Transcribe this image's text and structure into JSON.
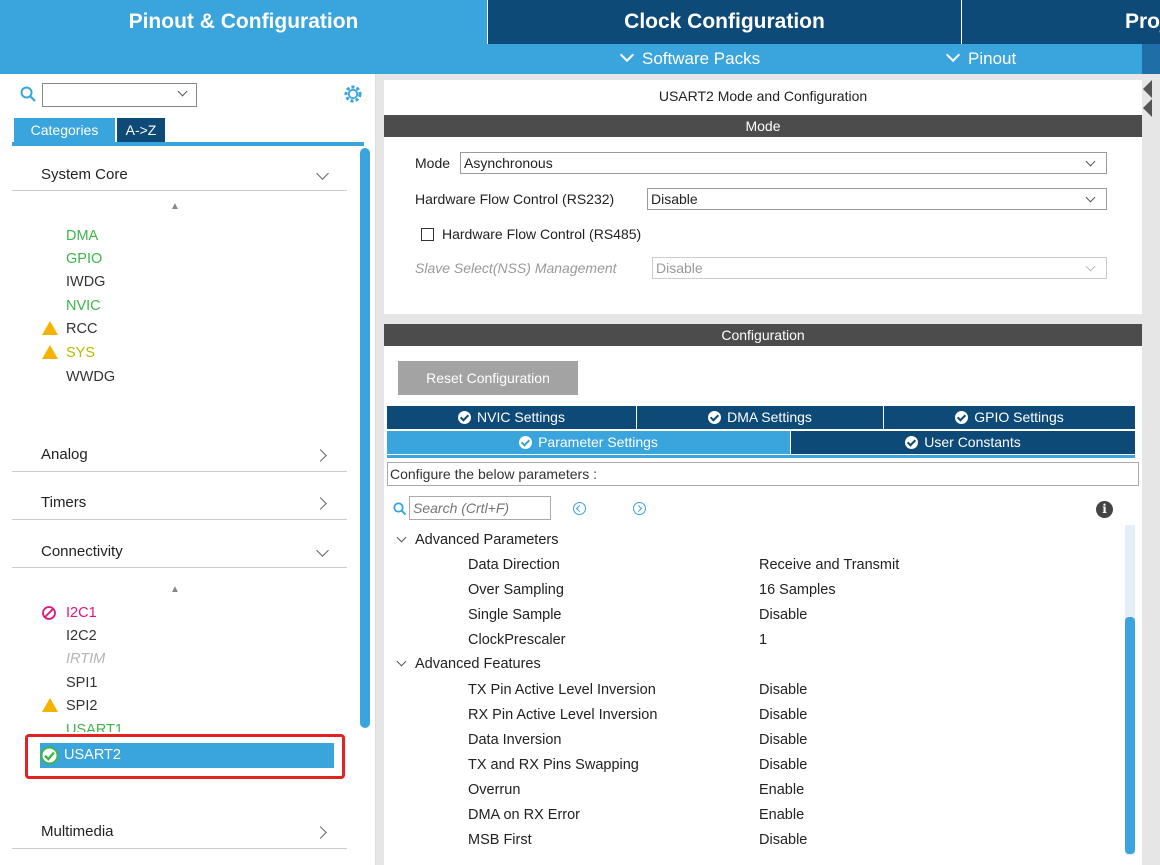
{
  "top_tabs": {
    "pinout": "Pinout & Configuration",
    "clock": "Clock Configuration",
    "project": "Proje"
  },
  "sub_menu": {
    "software_packs": "Software Packs",
    "pinout": "Pinout"
  },
  "left": {
    "search_value": "",
    "tabs": {
      "categories": "Categories",
      "az": "A->Z"
    },
    "groups": {
      "system_core": "System Core",
      "analog": "Analog",
      "timers": "Timers",
      "connectivity": "Connectivity",
      "multimedia": "Multimedia"
    },
    "system_core_items": [
      "DMA",
      "GPIO",
      "IWDG",
      "NVIC",
      "RCC",
      "SYS",
      "WWDG"
    ],
    "connectivity_items": [
      "I2C1",
      "I2C2",
      "IRTIM",
      "SPI1",
      "SPI2",
      "USART1",
      "USART2"
    ]
  },
  "mode_panel": {
    "title": "USART2 Mode and Configuration",
    "header": "Mode",
    "mode_label": "Mode",
    "mode_value": "Asynchronous",
    "hfc232_label": "Hardware Flow Control (RS232)",
    "hfc232_value": "Disable",
    "hfc485_label": "Hardware Flow Control (RS485)",
    "nss_label": "Slave Select(NSS) Management",
    "nss_value": "Disable"
  },
  "config_panel": {
    "header": "Configuration",
    "reset_button": "Reset Configuration",
    "tabs_row1": [
      "NVIC Settings",
      "DMA Settings",
      "GPIO Settings"
    ],
    "tabs_row2": [
      "Parameter Settings",
      "User Constants"
    ],
    "configure_text": "Configure the below parameters :",
    "search_placeholder": "Search (Crtl+F)",
    "sections": {
      "advanced_parameters": "Advanced Parameters",
      "advanced_features": "Advanced Features"
    },
    "advanced_parameters": [
      {
        "name": "Data Direction",
        "value": "Receive and Transmit"
      },
      {
        "name": "Over Sampling",
        "value": "16 Samples"
      },
      {
        "name": "Single Sample",
        "value": "Disable"
      },
      {
        "name": "ClockPrescaler",
        "value": "1"
      }
    ],
    "advanced_features": [
      {
        "name": "TX Pin Active Level Inversion",
        "value": "Disable"
      },
      {
        "name": "RX Pin Active Level Inversion",
        "value": "Disable"
      },
      {
        "name": "Data Inversion",
        "value": "Disable"
      },
      {
        "name": "TX and RX Pins Swapping",
        "value": "Disable"
      },
      {
        "name": "Overrun",
        "value": "Enable"
      },
      {
        "name": "DMA on RX Error",
        "value": "Enable"
      },
      {
        "name": "MSB First",
        "value": "Disable"
      }
    ]
  },
  "colors": {
    "navy": "#0d4a78",
    "light_blue": "#3aa4dd",
    "green": "#3db54a",
    "warning": "#f3b300",
    "error": "#e0167a",
    "highlight_box": "#e32222"
  }
}
